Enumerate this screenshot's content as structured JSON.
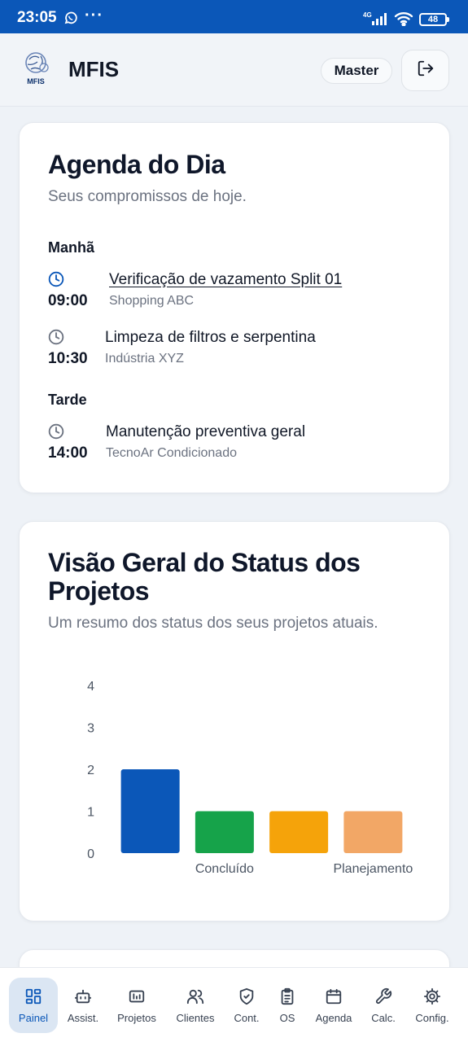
{
  "status_bar": {
    "time": "23:05",
    "more": "···",
    "network": "4G",
    "battery": "48"
  },
  "app_bar": {
    "title": "MFIS",
    "logo_text": "MFIS",
    "role_button": "Master",
    "logout_icon": "logout-icon"
  },
  "agenda": {
    "title": "Agenda do Dia",
    "subtitle": "Seus compromissos de hoje.",
    "sections": [
      {
        "label": "Manhã",
        "items": [
          {
            "time": "09:00",
            "title": "Verificação de vazamento Split 01",
            "client": "Shopping ABC"
          },
          {
            "time": "10:30",
            "title": "Limpeza de filtros e serpentina",
            "client": "Indústria XYZ"
          }
        ]
      },
      {
        "label": "Tarde",
        "items": [
          {
            "time": "14:00",
            "title": "Manutenção preventiva geral",
            "client": "TecnoAr Condicionado"
          }
        ]
      }
    ]
  },
  "status_overview": {
    "title": "Visão Geral do Status dos Projetos",
    "subtitle": "Um resumo dos status dos seus projetos atuais."
  },
  "chart_data": {
    "type": "bar",
    "categories": [
      "",
      "Concluído",
      "",
      "Planejamento"
    ],
    "values": [
      2,
      1,
      1,
      1
    ],
    "colors": [
      "#0b57b8",
      "#16a34a",
      "#f5a30a",
      "#f2a766"
    ],
    "yticks": [
      0,
      1,
      2,
      3,
      4
    ],
    "ylim": [
      0,
      4
    ],
    "title": "",
    "xlabel": "",
    "ylabel": ""
  },
  "bottom_nav": [
    {
      "label": "Painel",
      "icon": "dashboard-icon",
      "active": true
    },
    {
      "label": "Assist.",
      "icon": "robot-icon",
      "active": false
    },
    {
      "label": "Projetos",
      "icon": "projects-icon",
      "active": false
    },
    {
      "label": "Clientes",
      "icon": "users-icon",
      "active": false
    },
    {
      "label": "Cont.",
      "icon": "shield-check-icon",
      "active": false
    },
    {
      "label": "OS",
      "icon": "clipboard-icon",
      "active": false
    },
    {
      "label": "Agenda",
      "icon": "calendar-icon",
      "active": false
    },
    {
      "label": "Calc.",
      "icon": "wrench-icon",
      "active": false
    },
    {
      "label": "Config.",
      "icon": "gear-icon",
      "active": false
    }
  ],
  "colors": {
    "primary": "#0b57b8",
    "background": "#eef2f7",
    "muted_text": "#6b7280"
  }
}
